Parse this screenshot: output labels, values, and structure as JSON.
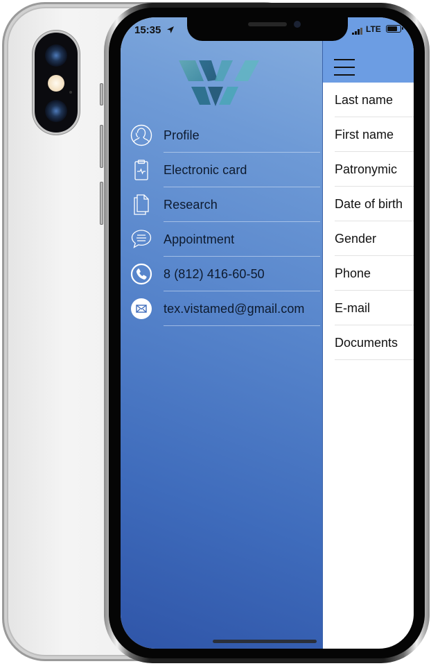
{
  "status_bar": {
    "time": "15:35",
    "location_icon": "location-arrow-icon",
    "network": "LTE",
    "signal_icon": "cellular-signal-icon",
    "battery_icon": "battery-icon",
    "battery_level_percent": 85
  },
  "drawer": {
    "logo": "vistamed-logo",
    "background_color_top": "#86aedf",
    "background_color_bottom": "#2f55a8",
    "items": [
      {
        "label": "Profile",
        "icon": "user-profile-icon"
      },
      {
        "label": "Electronic card",
        "icon": "clipboard-pulse-icon"
      },
      {
        "label": "Research",
        "icon": "documents-icon"
      },
      {
        "label": "Appointment",
        "icon": "chat-bubble-icon"
      },
      {
        "label": "8 (812) 416-60-50",
        "icon": "phone-icon"
      },
      {
        "label": "tex.vistamed@gmail.com",
        "icon": "email-icon"
      }
    ]
  },
  "panel": {
    "header_color": "#6c9de3",
    "menu_icon": "hamburger-menu-icon",
    "fields": [
      {
        "label": "Last name"
      },
      {
        "label": "First name"
      },
      {
        "label": "Patronymic"
      },
      {
        "label": "Date of birth"
      },
      {
        "label": "Gender"
      },
      {
        "label": "Phone"
      },
      {
        "label": "E-mail"
      },
      {
        "label": "Documents"
      }
    ]
  }
}
